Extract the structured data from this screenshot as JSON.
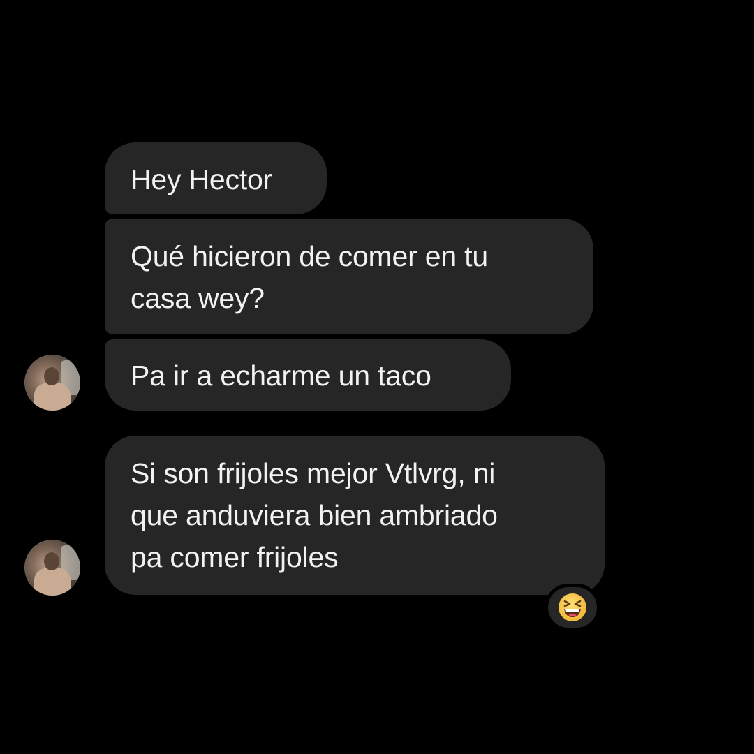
{
  "conversation": {
    "messages": [
      {
        "lines": [
          "Hey Hector"
        ]
      },
      {
        "lines": [
          "Qué hicieron de comer en tu",
          "casa wey?"
        ]
      },
      {
        "lines": [
          "Pa ir a echarme un taco"
        ]
      },
      {
        "lines": [
          "Si son frijoles mejor Vtlvrg, ni",
          "que anduviera bien ambriado",
          "pa comer frijoles"
        ]
      }
    ],
    "reaction": {
      "icon": "laughing-emoji-icon"
    }
  },
  "colors": {
    "background": "#000000",
    "bubble": "#262626",
    "text": "#f2f2f2",
    "emoji": "#f7c948"
  }
}
